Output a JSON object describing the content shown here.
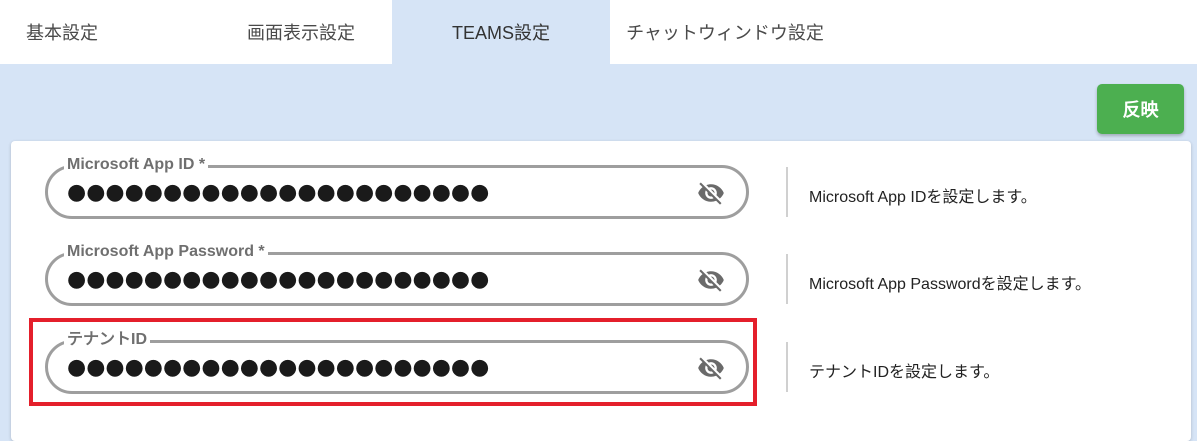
{
  "tabs": [
    {
      "label": "基本設定"
    },
    {
      "label": "画面表示設定"
    },
    {
      "label": "TEAMS設定"
    },
    {
      "label": "チャットウィンドウ設定"
    }
  ],
  "apply_label": "反映",
  "fields": [
    {
      "label": "Microsoft App ID *",
      "value": "●●●●●●●●●●●●●●●●●●●●●●",
      "description": "Microsoft App IDを設定します。",
      "icon": "eye-off-icon"
    },
    {
      "label": "Microsoft App Password *",
      "value": "●●●●●●●●●●●●●●●●●●●●●●",
      "description": "Microsoft App Passwordを設定します。",
      "icon": "eye-off-icon"
    },
    {
      "label": "テナントID",
      "value": "●●●●●●●●●●●●●●●●●●●●●●",
      "description": "テナントIDを設定します。",
      "icon": "eye-off-icon"
    }
  ],
  "colors": {
    "tab_active_bg": "#d6e4f6",
    "apply_button": "#4caf50",
    "highlight_border": "#e41f2b",
    "field_border": "#9e9e9e"
  }
}
